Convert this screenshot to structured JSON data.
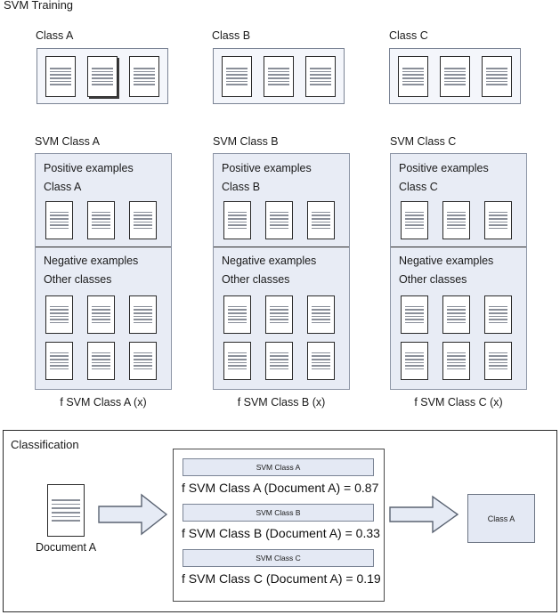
{
  "diagram": {
    "title": "SVM Training",
    "classification_title": "Classification"
  },
  "training": {
    "class_boxes": [
      {
        "label": "Class A",
        "doc_count": 3
      },
      {
        "label": "Class B",
        "doc_count": 3
      },
      {
        "label": "Class C",
        "doc_count": 3
      }
    ],
    "svm_panels": [
      {
        "title": "SVM Class A",
        "positive_heading": "Positive examples",
        "positive_sub": "Class A",
        "positive_doc_count": 3,
        "negative_heading": "Negative examples",
        "negative_sub": "Other classes",
        "negative_doc_count": 6,
        "function_caption": "f SVM Class A (x)"
      },
      {
        "title": "SVM Class B",
        "positive_heading": "Positive examples",
        "positive_sub": "Class B",
        "positive_doc_count": 3,
        "negative_heading": "Negative examples",
        "negative_sub": "Other classes",
        "negative_doc_count": 6,
        "function_caption": "f SVM Class B (x)"
      },
      {
        "title": "SVM Class C",
        "positive_heading": "Positive examples",
        "positive_sub": "Class C",
        "positive_doc_count": 3,
        "negative_heading": "Negative examples",
        "negative_sub": "Other classes",
        "negative_doc_count": 6,
        "function_caption": "f SVM Class C (x)"
      }
    ]
  },
  "classification": {
    "input_document_label": "Document A",
    "scores": [
      {
        "pill": "SVM Class A",
        "line": "f SVM Class A (Document A) = 0.87",
        "value": 0.87
      },
      {
        "pill": "SVM Class B",
        "line": "f SVM Class B (Document A) = 0.33",
        "value": 0.33
      },
      {
        "pill": "SVM Class C",
        "line": "f SVM Class C (Document A) = 0.19",
        "value": 0.19
      }
    ],
    "result_label": "Class A"
  },
  "colors": {
    "panel_fill": "#e8ecf5",
    "classbox_fill": "#f4f6fb",
    "pill_fill": "#e4e9f4",
    "arrow_fill": "#e6ebf5",
    "border_dark": "#2b2b2b",
    "border_gray": "#7b8495"
  }
}
